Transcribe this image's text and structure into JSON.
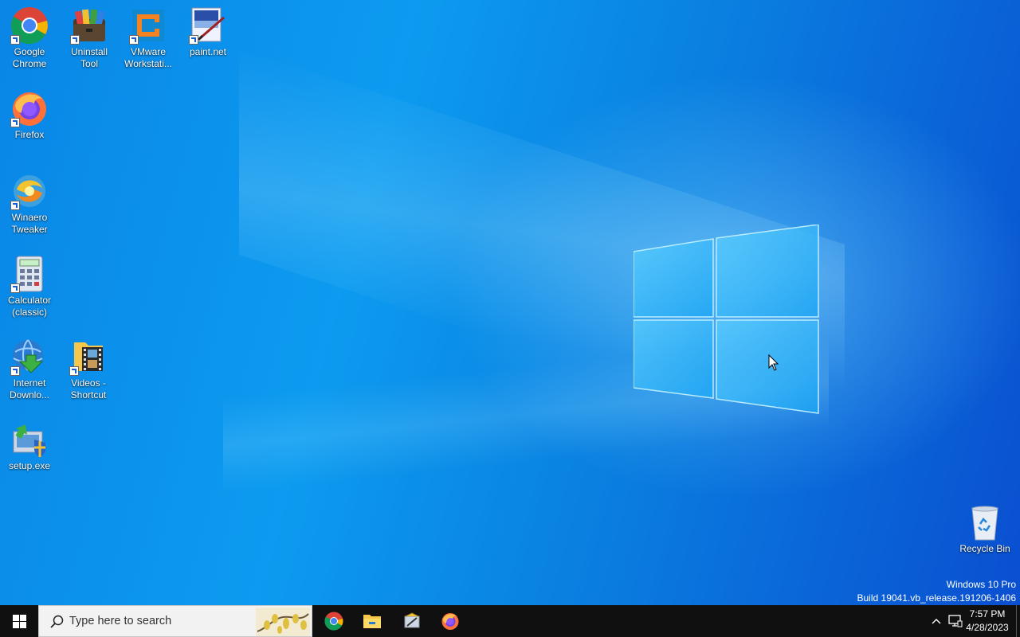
{
  "desktop": {
    "icons": [
      {
        "label": "Google Chrome",
        "icon": "chrome-icon"
      },
      {
        "label": "Uninstall Tool",
        "icon": "uninstall-tool-icon"
      },
      {
        "label": "VMware Workstati...",
        "icon": "vmware-icon"
      },
      {
        "label": "paint.net",
        "icon": "paintnet-icon"
      },
      {
        "label": "Firefox",
        "icon": "firefox-icon"
      },
      {
        "label": "Winaero Tweaker",
        "icon": "winaero-tweaker-icon"
      },
      {
        "label": "Calculator (classic)",
        "icon": "calculator-icon"
      },
      {
        "label": "Internet Downlo...",
        "icon": "internet-download-manager-icon"
      },
      {
        "label": "Videos - Shortcut",
        "icon": "videos-folder-icon"
      },
      {
        "label": "setup.exe",
        "icon": "setup-installer-icon"
      },
      {
        "label": "Recycle Bin",
        "icon": "recycle-bin-icon"
      }
    ],
    "watermark": {
      "line1": "Windows 10 Pro",
      "line2": "Build 19041.vb_release.191206-1406"
    }
  },
  "taskbar": {
    "search_placeholder": "Type here to search",
    "pinned": [
      "chrome-icon",
      "file-explorer-icon",
      "winaero-tweaker-icon",
      "firefox-icon"
    ],
    "clock": {
      "time": "7:57 PM",
      "date": "4/28/2023"
    }
  },
  "colors": {
    "taskbar": "#101010",
    "wallpaper_blue": "#0a86e6"
  }
}
